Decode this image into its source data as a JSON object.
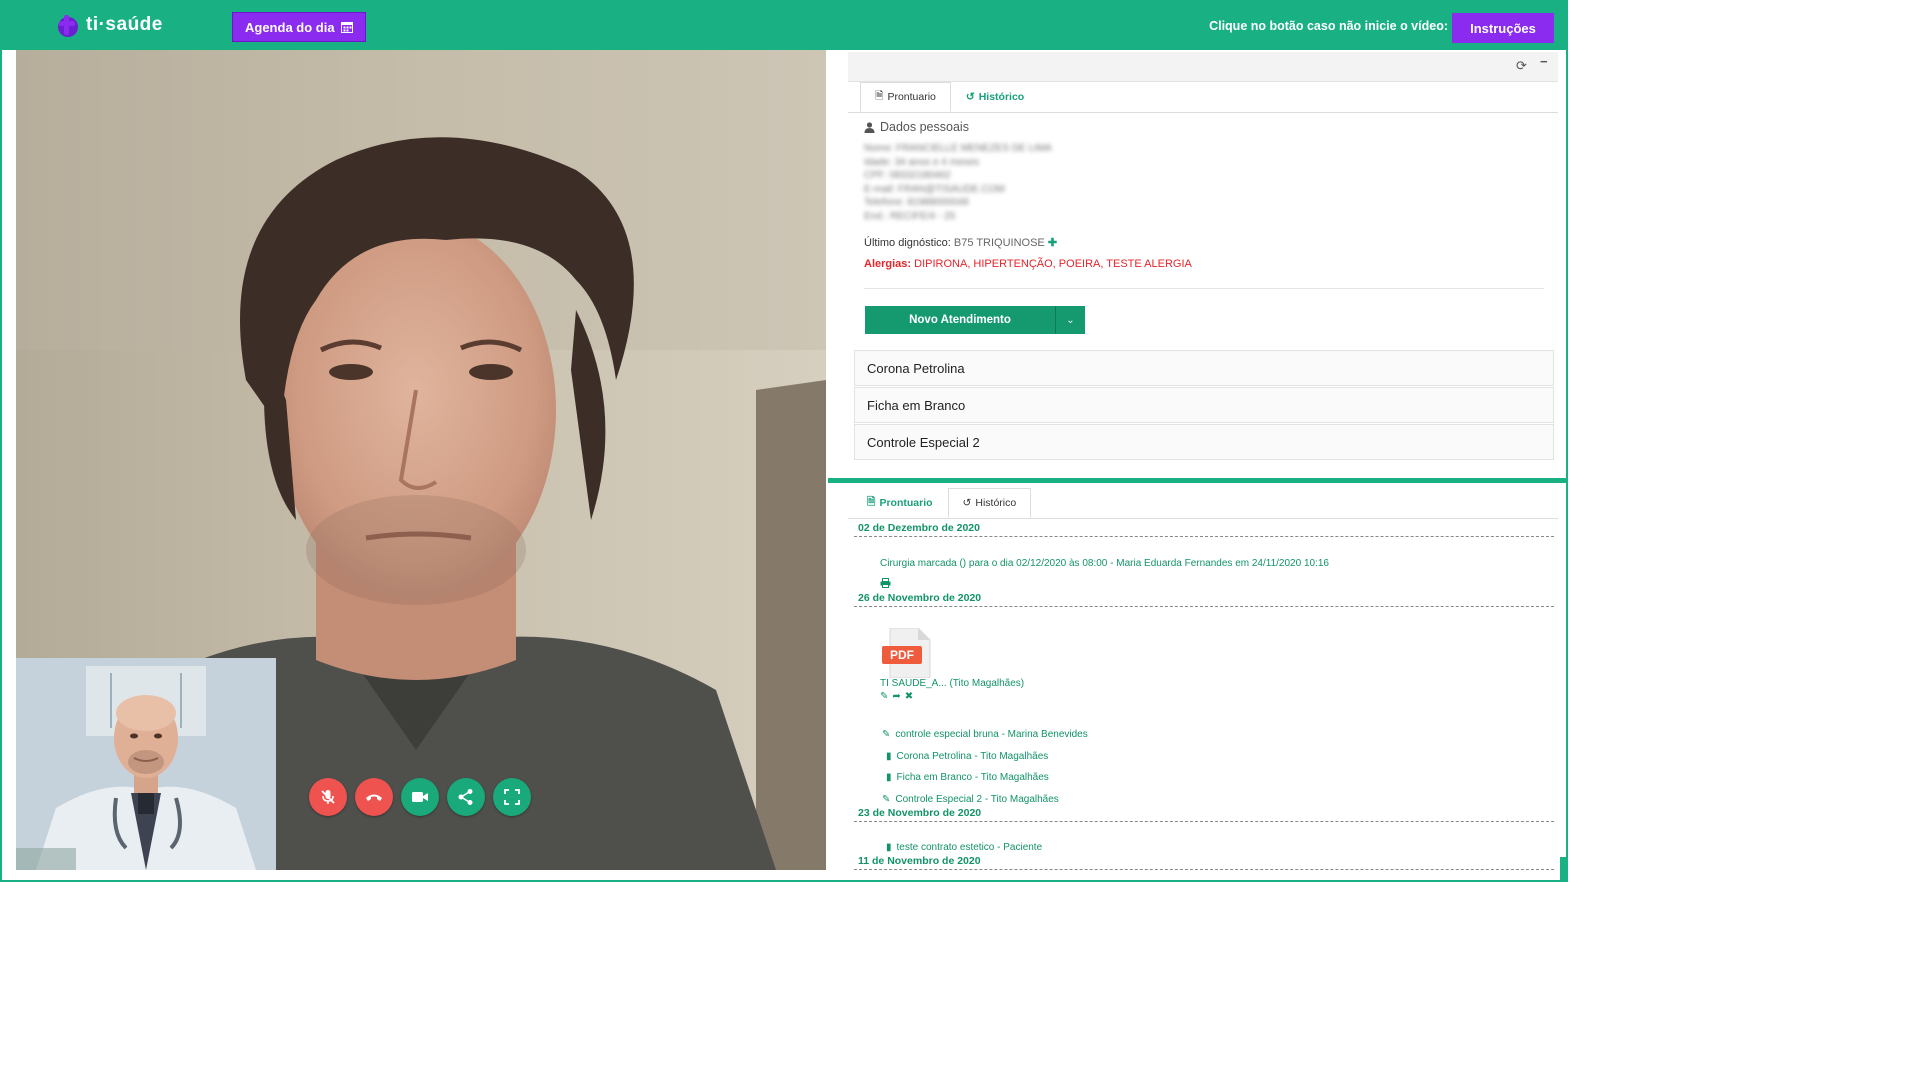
{
  "app": {
    "logo_text": "ti·saúde",
    "agenda_button": "Agenda do dia",
    "hint_text": "Clique no botão caso não inicie o vídeo:",
    "instructions_button": "Instruções"
  },
  "colors": {
    "brand_green": "#19b184",
    "accent_purple": "#8b2bf0",
    "danger_red": "#ef5350",
    "allergy_red": "#e5242b"
  },
  "call_controls": [
    {
      "name": "mute-mic-button",
      "icon": "mic-off-icon",
      "color": "red"
    },
    {
      "name": "hang-up-button",
      "icon": "phone-hangup-icon",
      "color": "red"
    },
    {
      "name": "camera-button",
      "icon": "video-camera-icon",
      "color": "green"
    },
    {
      "name": "share-button",
      "icon": "share-icon",
      "color": "green"
    },
    {
      "name": "fullscreen-button",
      "icon": "fullscreen-icon",
      "color": "green"
    }
  ],
  "panel_top": {
    "tabs": [
      {
        "label": "Prontuario",
        "icon": "file-icon",
        "active": true
      },
      {
        "label": "Histórico",
        "icon": "history-icon",
        "active": false
      }
    ],
    "personal_title": "Dados pessoais",
    "personal_fields": [
      "Nome: FRANCIELLE MENEZES DE LIMA",
      "Idade: 34 anos e 4 meses",
      "CPF: 08332180462",
      "E-mail: FRAN@TISAUDE.COM",
      "Telefone: 81988000048",
      "End.: RECIFE/4 - 25"
    ],
    "diagnosis_label": "Último dignóstico:",
    "diagnosis_value": "B75 TRIQUINOSE",
    "allergies_label": "Alergias:",
    "allergies_value": "DIPIRONA, HIPERTENÇÃO, POEIRA, TESTE ALERGIA",
    "new_button": "Novo Atendimento",
    "forms": [
      "Corona Petrolina",
      "Ficha em Branco",
      "Controle Especial 2"
    ]
  },
  "panel_bottom": {
    "tabs": [
      {
        "label": "Prontuario",
        "icon": "file-icon",
        "active": false
      },
      {
        "label": "Histórico",
        "icon": "history-icon",
        "active": true
      }
    ],
    "date_1": "02 de Dezembro de 2020",
    "entry_1": "Cirurgia marcada () para o dia 02/12/2020 às 08:00 - Maria Eduarda Fernandes em 24/11/2020 10:16",
    "date_2": "26 de Novembro de 2020",
    "pdf_badge": "PDF",
    "pdf_caption": "TI SAUDE_A... (Tito Magalhães)",
    "entries_2": [
      {
        "icon": "edit-icon",
        "text": "controle especial bruna - Marina Benevides"
      },
      {
        "icon": "clipboard-icon",
        "text": "Corona Petrolina - Tito Magalhães"
      },
      {
        "icon": "clipboard-icon",
        "text": "Ficha em Branco - Tito Magalhães"
      },
      {
        "icon": "edit-icon",
        "text": "Controle Especial 2 - Tito Magalhães"
      }
    ],
    "date_3": "23 de Novembro de 2020",
    "entry_3": "teste contrato estetico - Paciente",
    "date_4": "11 de Novembro de 2020"
  }
}
